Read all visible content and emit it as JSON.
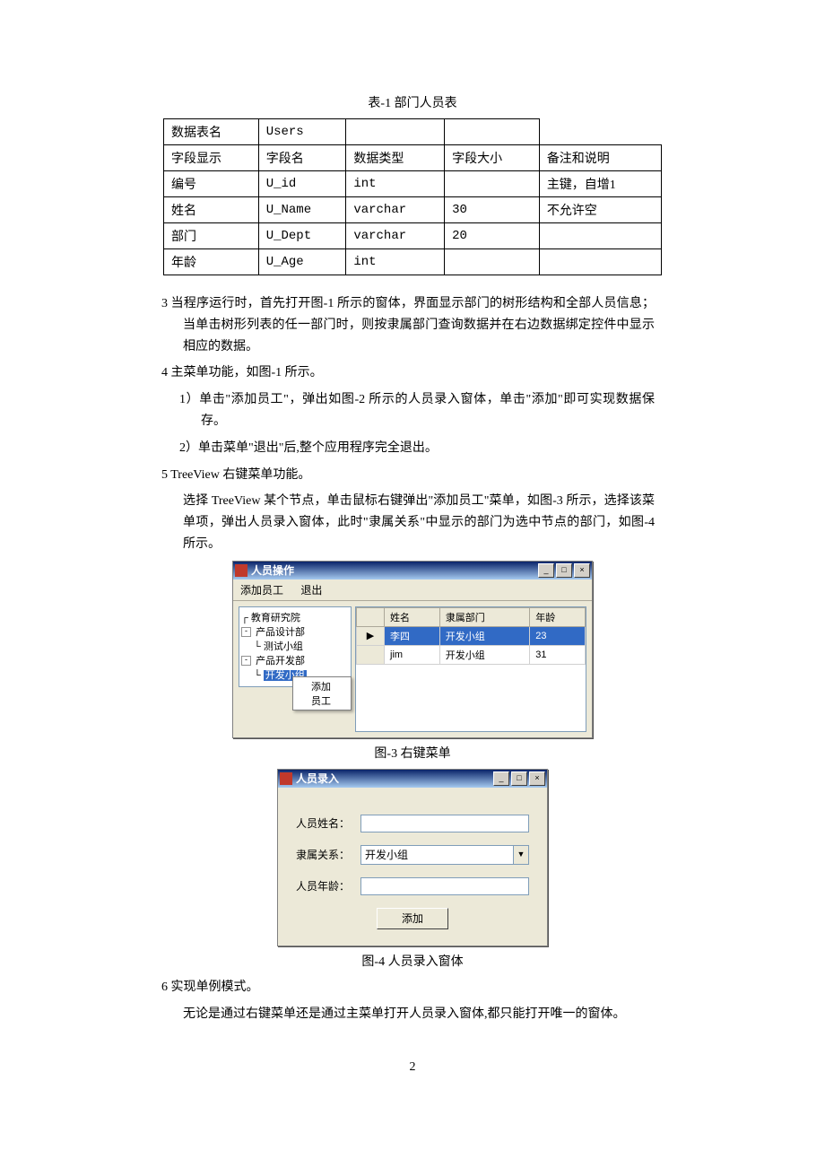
{
  "tableCaption": "表-1 部门人员表",
  "dtable": {
    "r1": {
      "c1": "数据表名",
      "c2": "Users"
    },
    "r2": {
      "c1": "字段显示",
      "c2": "字段名",
      "c3": "数据类型",
      "c4": "字段大小",
      "c5": "备注和说明"
    },
    "r3": {
      "c1": "编号",
      "c2": "U_id",
      "c3": "int",
      "c5": "主键，自增1"
    },
    "r4": {
      "c1": "姓名",
      "c2": "U_Name",
      "c3": "varchar",
      "c4": "30",
      "c5": "不允许空"
    },
    "r5": {
      "c1": "部门",
      "c2": "U_Dept",
      "c3": "varchar",
      "c4": "20"
    },
    "r6": {
      "c1": "年龄",
      "c2": "U_Age",
      "c3": "int"
    }
  },
  "para3": "3 当程序运行时，首先打开图-1 所示的窗体，界面显示部门的树形结构和全部人员信息；当单击树形列表的任一部门时，则按隶属部门查询数据并在右边数据绑定控件中显示相应的数据。",
  "para4": "4 主菜单功能，如图-1 所示。",
  "para4_1": "1）单击\"添加员工\"，弹出如图-2 所示的人员录入窗体，单击\"添加\"即可实现数据保存。",
  "para4_2": "2）单击菜单\"退出\"后,整个应用程序完全退出。",
  "para5": "5 TreeView 右键菜单功能。",
  "para5_1": "选择 TreeView 某个节点，单击鼠标右键弹出\"添加员工\"菜单，如图-3 所示，选择该菜单项，弹出人员录入窗体，此时\"隶属关系\"中显示的部门为选中节点的部门，如图-4 所示。",
  "win1": {
    "title": "人员操作",
    "menu": {
      "m1": "添加员工",
      "m2": "退出"
    },
    "tree": {
      "n1": "教育研究院",
      "n2": "产品设计部",
      "n3": "测试小组",
      "n4": "产品开发部",
      "n5": "开发小组"
    },
    "ctx": "添加员工",
    "grid": {
      "h1": "姓名",
      "h2": "隶属部门",
      "h3": "年龄",
      "row1": {
        "c1": "李四",
        "c2": "开发小组",
        "c3": "23"
      },
      "row2": {
        "c1": "jim",
        "c2": "开发小组",
        "c3": "31"
      }
    }
  },
  "cap3": "图-3 右键菜单",
  "win2": {
    "title": "人员录入",
    "l1": "人员姓名：",
    "l2": "隶属关系：",
    "l3": "人员年龄：",
    "dept": "开发小组",
    "btn": "添加"
  },
  "cap4": "图-4 人员录入窗体",
  "para6": "6 实现单例模式。",
  "para6_1": "无论是通过右键菜单还是通过主菜单打开人员录入窗体,都只能打开唯一的窗体。",
  "pagenum": "2"
}
